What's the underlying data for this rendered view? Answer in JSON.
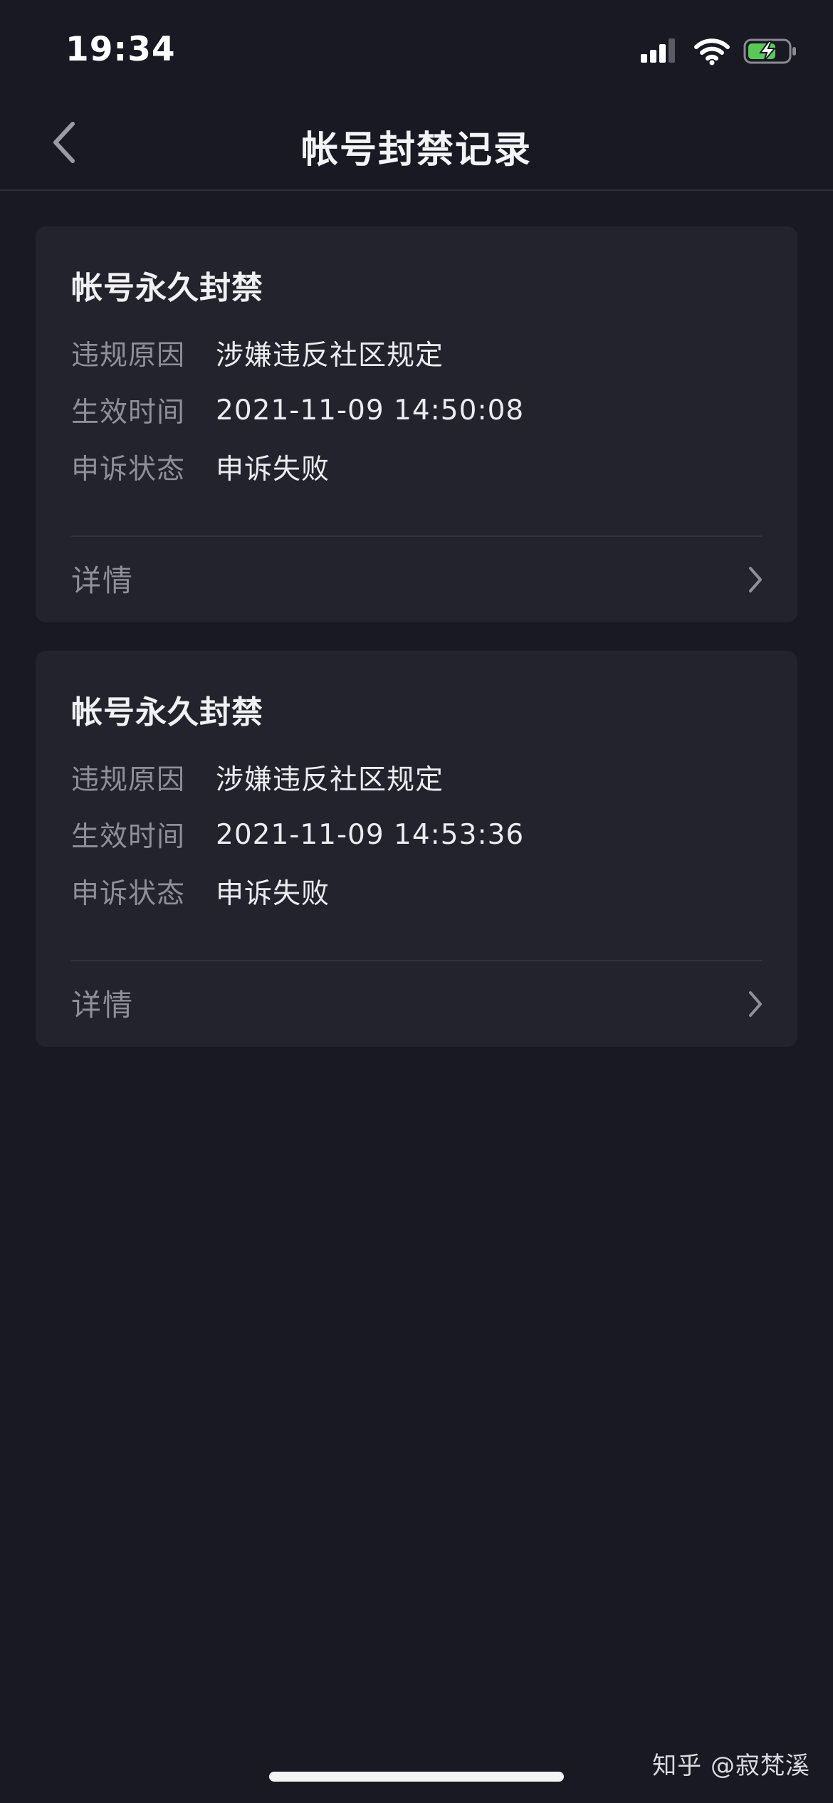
{
  "status_bar": {
    "time": "19:34",
    "icons": [
      "cellular-signal-icon",
      "wifi-icon",
      "battery-charging-icon"
    ],
    "battery_color": "#5ac95a"
  },
  "nav": {
    "title": "帐号封禁记录",
    "back_icon": "chevron-left-icon"
  },
  "records": [
    {
      "title": "帐号永久封禁",
      "rows": [
        {
          "label": "违规原因",
          "value": "涉嫌违反社区规定"
        },
        {
          "label": "生效时间",
          "value": "2021-11-09 14:50:08"
        },
        {
          "label": "申诉状态",
          "value": "申诉失败"
        }
      ],
      "detail_label": "详情"
    },
    {
      "title": "帐号永久封禁",
      "rows": [
        {
          "label": "违规原因",
          "value": "涉嫌违反社区规定"
        },
        {
          "label": "生效时间",
          "value": "2021-11-09 14:53:36"
        },
        {
          "label": "申诉状态",
          "value": "申诉失败"
        }
      ],
      "detail_label": "详情"
    }
  ],
  "watermark": "知乎 @寂梵溪",
  "colors": {
    "background": "#181922",
    "card": "#22232c",
    "label": "#8e8f98",
    "value": "#ececf0"
  }
}
